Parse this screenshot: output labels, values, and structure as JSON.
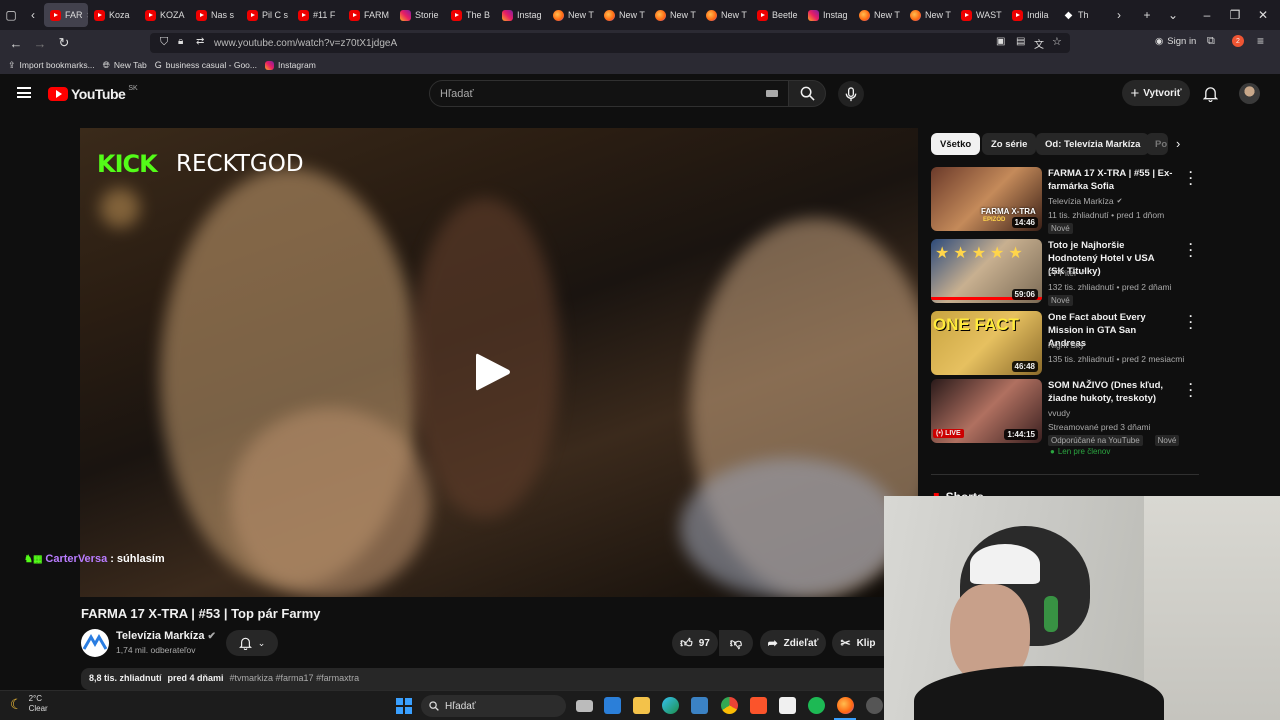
{
  "browser": {
    "tabs": [
      {
        "label": "FAR",
        "icon": "yt",
        "active": true
      },
      {
        "label": "Koza",
        "icon": "yt"
      },
      {
        "label": "KOZA",
        "icon": "yt"
      },
      {
        "label": "Nas s",
        "icon": "yt"
      },
      {
        "label": "Pil C s",
        "icon": "yt"
      },
      {
        "label": "#11 F",
        "icon": "yt"
      },
      {
        "label": "FARM",
        "icon": "yt"
      },
      {
        "label": "Storie",
        "icon": "ig"
      },
      {
        "label": "The B",
        "icon": "yt"
      },
      {
        "label": "Instag",
        "icon": "ig"
      },
      {
        "label": "New T",
        "icon": "ff"
      },
      {
        "label": "New T",
        "icon": "ff"
      },
      {
        "label": "New T",
        "icon": "ff"
      },
      {
        "label": "New T",
        "icon": "ff"
      },
      {
        "label": "Beetle",
        "icon": "yt"
      },
      {
        "label": "Instag",
        "icon": "ig"
      },
      {
        "label": "New T",
        "icon": "ff"
      },
      {
        "label": "New T",
        "icon": "ff"
      },
      {
        "label": "WAST",
        "icon": "yt"
      },
      {
        "label": "Indila",
        "icon": "yt"
      },
      {
        "label": "Th",
        "icon": "wh"
      }
    ],
    "url": "www.youtube.com/watch?v=z70tX1jdgeA",
    "sign_in": "Sign in",
    "bookmarks": [
      {
        "label": "Import bookmarks...",
        "icon": "import"
      },
      {
        "label": "New Tab",
        "icon": "globe"
      },
      {
        "label": "business casual - Goo...",
        "icon": "google"
      },
      {
        "label": "Instagram",
        "icon": "ig"
      }
    ]
  },
  "youtube": {
    "logo_text": "YouTube",
    "region": "SK",
    "search_placeholder": "Hľadať",
    "create_label": "Vytvoriť"
  },
  "video": {
    "overlay_brand": "KICK",
    "overlay_channel": "RECKTGOD",
    "chat_user": "CarterVersa",
    "chat_message": ": súhlasím",
    "title": "FARMA 17 X-TRA | #53 | Top pár Farmy",
    "channel": "Televízia Markíza",
    "subscribers": "1,74 mil. odberateľov",
    "likes": "97",
    "share_label": "Zdieľať",
    "clip_label": "Klip",
    "views": "8,8 tis. zhliadnutí",
    "age": "pred 4 dňami",
    "tags": "#tvmarkiza #farma17 #farmaxtra"
  },
  "sidebar": {
    "chips": [
      {
        "label": "Všetko",
        "selected": true
      },
      {
        "label": "Zo série"
      },
      {
        "label": "Od: Televízia Markíza"
      },
      {
        "label": "Po"
      }
    ],
    "recommendations": [
      {
        "title": "FARMA 17 X-TRA | #55 | Ex-farmárka Sofia",
        "channel": "Televízia Markíza",
        "verified": true,
        "meta": "11 tis. zhliadnutí • pred 1 dňom",
        "badges": [
          "Nové"
        ],
        "duration": "14:46"
      },
      {
        "title": "Toto je Najhoršie Hodnotený Hotel v USA (SK Titulky)",
        "channel": "PPPiter",
        "verified": true,
        "meta": "132 tis. zhliadnutí • pred 2 dňami",
        "badges": [
          "Nové"
        ],
        "duration": "59:06"
      },
      {
        "title": "One Fact about Every Mission in GTA San Andreas",
        "channel": "Night Sky",
        "verified": false,
        "meta": "135 tis. zhliadnutí • pred 2 mesiacmi",
        "badges": [],
        "duration": "46:48"
      },
      {
        "title": "SOM NAŽIVO (Dnes kľud, žiadne hukoty, treskoty)",
        "channel": "vvudy",
        "verified": false,
        "meta": "Streamované pred 3 dňami",
        "badges": [
          "Odporúčané na YouTube",
          "Nové"
        ],
        "members": "Len pre členov",
        "duration": "1:44:15",
        "live": "LIVE"
      }
    ],
    "shorts_label": "Shorts"
  },
  "thumbs": {
    "t1_text": "FARMA X-TRA",
    "t1_sub": "EPIZÓD",
    "t3_text": "ONE FACT"
  },
  "taskbar": {
    "temperature": "2°C",
    "condition": "Clear",
    "search_placeholder": "Hľadať"
  }
}
